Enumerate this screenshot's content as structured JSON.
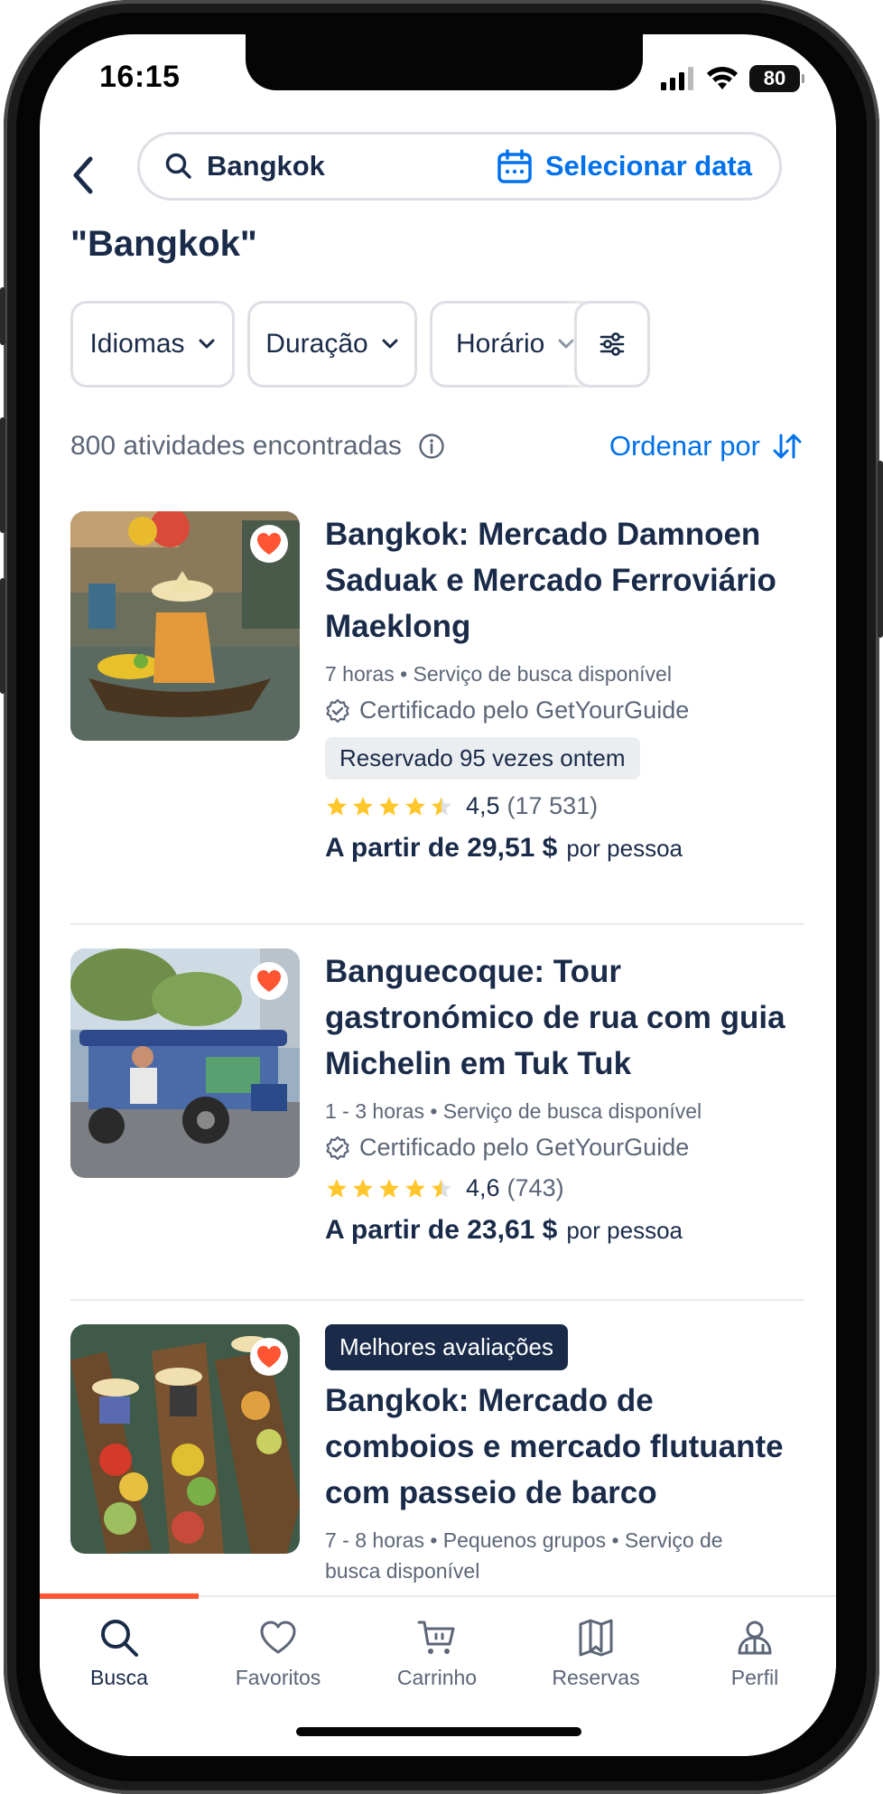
{
  "status_bar": {
    "time": "16:15",
    "battery": "80"
  },
  "search": {
    "query": "Bangkok",
    "date_label": "Selecionar data"
  },
  "page_title": "\"Bangkok\"",
  "filters": {
    "languages": "Idiomas",
    "duration": "Duração",
    "time": "Horário"
  },
  "results": {
    "count_text": "800 atividades encontradas",
    "sort_label": "Ordenar por"
  },
  "activities": [
    {
      "title_lines": [
        "Bangkok: Mercado Damnoen",
        "Saduak e Mercado Ferroviário",
        "Maeklong"
      ],
      "meta": "7 horas • Serviço de busca disponível",
      "certified": "Certificado pelo GetYourGuide",
      "booked": "Reservado 95 vezes ontem",
      "rating": "4,5",
      "reviews": "(17 531)",
      "stars": 4.5,
      "price": "A partir de 29,51 $",
      "per": "por pessoa"
    },
    {
      "title_lines": [
        "Banguecoque: Tour",
        "gastronómico de rua com guia",
        "Michelin em Tuk Tuk"
      ],
      "meta": "1 - 3 horas • Serviço de busca disponível",
      "certified": "Certificado pelo GetYourGuide",
      "rating": "4,6",
      "reviews": "(743)",
      "stars": 4.5,
      "price": "A partir de 23,61 $",
      "per": "por pessoa"
    },
    {
      "badge": "Melhores avaliações",
      "title_lines": [
        "Bangkok: Mercado de",
        "comboios e mercado flutuante",
        "com passeio de barco"
      ],
      "meta_lines": [
        "7 - 8 horas • Pequenos grupos • Serviço de",
        "busca disponível"
      ]
    }
  ],
  "tabs": [
    {
      "label": "Busca",
      "icon": "search-icon",
      "active": true
    },
    {
      "label": "Favoritos",
      "icon": "heart-icon"
    },
    {
      "label": "Carrinho",
      "icon": "cart-icon"
    },
    {
      "label": "Reservas",
      "icon": "bookmark-map-icon"
    },
    {
      "label": "Perfil",
      "icon": "profile-icon"
    }
  ],
  "colors": {
    "brand_blue": "#0071eb",
    "navy": "#1a2b49",
    "heart": "#ff5533",
    "star": "#ffc72c"
  }
}
